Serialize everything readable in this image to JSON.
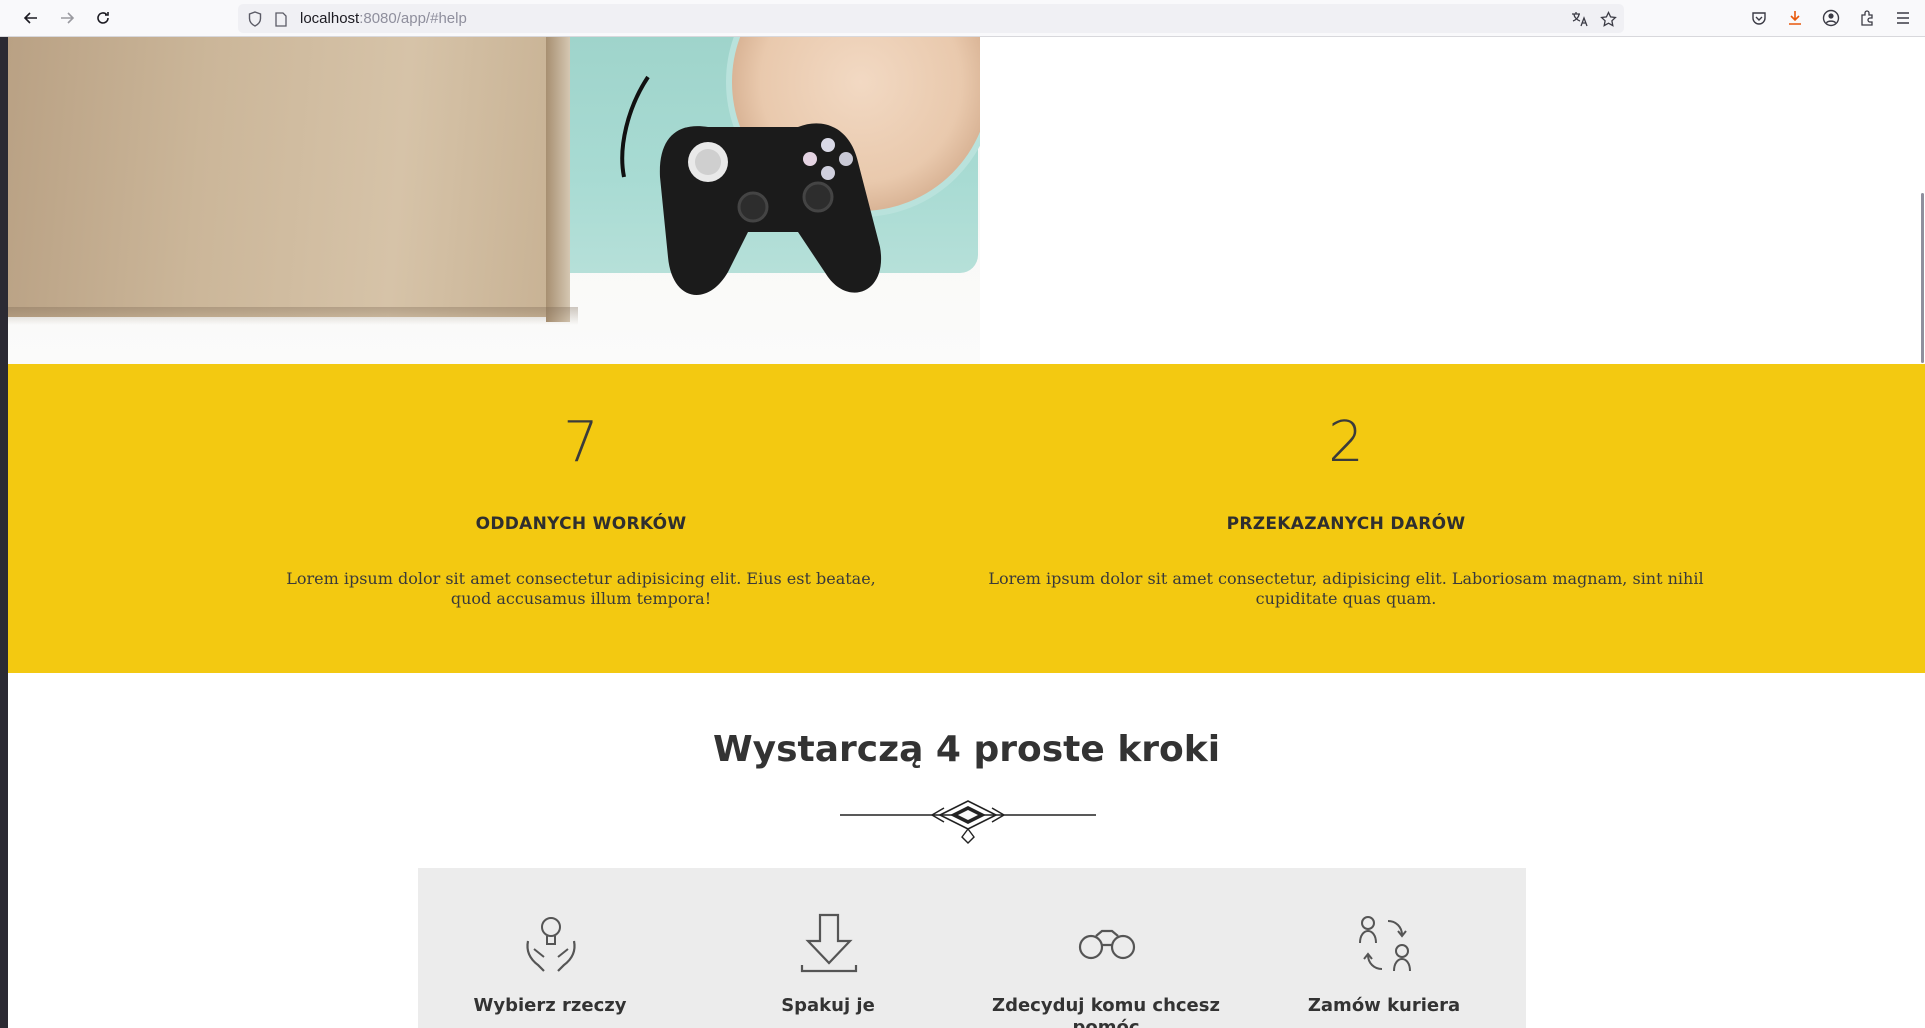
{
  "browser": {
    "url_host": "localhost",
    "url_rest": ":8080/app/#help",
    "back_icon": "arrow-left-icon",
    "forward_icon": "arrow-right-icon",
    "reload_icon": "reload-icon"
  },
  "stats": [
    {
      "number": "7",
      "label": "ODDANYCH WORKÓW",
      "text": "Lorem ipsum dolor sit amet consectetur adipisicing elit. Eius est beatae, quod accusamus illum tempora!"
    },
    {
      "number": "2",
      "label": "PRZEKAZANYCH DARÓW",
      "text": "Lorem ipsum dolor sit amet consectetur, adipisicing elit. Laboriosam magnam, sint nihil cupiditate quas quam."
    }
  ],
  "steps": {
    "title": "Wystarczą 4 proste kroki",
    "items": [
      {
        "label": "Wybierz rzeczy",
        "icon": "hands-lightbulb-icon"
      },
      {
        "label": "Spakuj je",
        "icon": "download-arrow-icon"
      },
      {
        "label": "Zdecyduj komu chcesz pomóc",
        "icon": "binoculars-icon"
      },
      {
        "label": "Zamów kuriera",
        "icon": "people-exchange-icon"
      }
    ]
  },
  "colors": {
    "stats_background": "#f3c911",
    "steps_background": "#ececec",
    "text_dark": "#333333"
  }
}
